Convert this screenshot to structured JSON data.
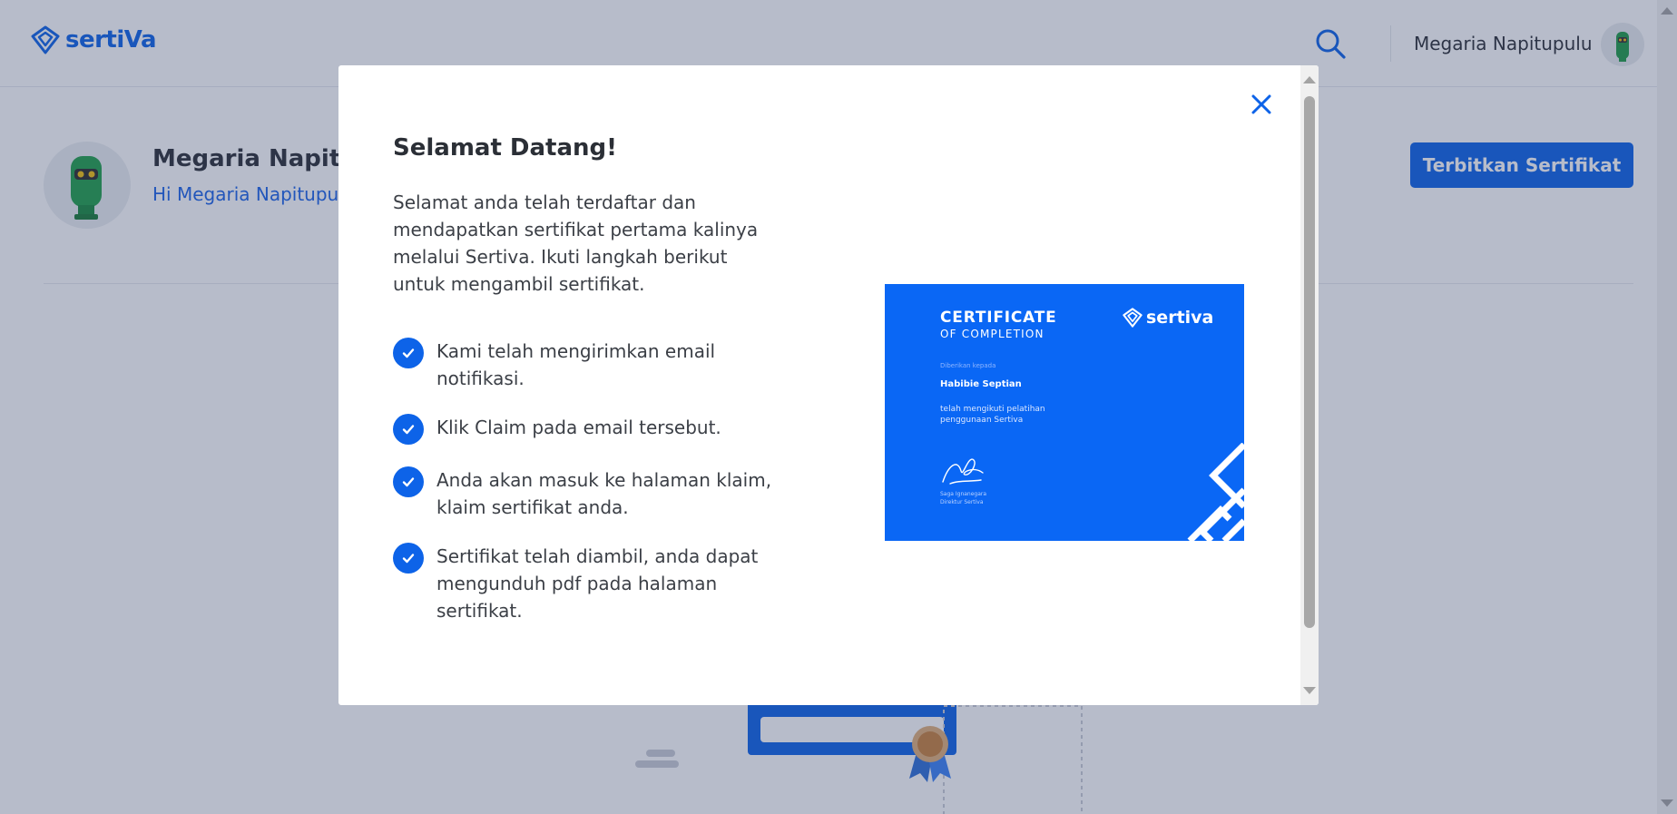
{
  "header": {
    "logo_text": "sertiVa",
    "user_name": "Megaria Napitupulu"
  },
  "profile": {
    "name": "Megaria Napitup",
    "greeting": "Hi Megaria Napitupul",
    "publish_button": "Terbitkan Sertifikat"
  },
  "modal": {
    "title": "Selamat Datang!",
    "intro": "Selamat anda telah terdaftar dan mendapatkan sertifikat pertama kalinya melalui Sertiva. Ikuti langkah berikut untuk mengambil sertifikat.",
    "steps": [
      "Kami telah mengirimkan email notifikasi.",
      "Klik Claim pada email tersebut.",
      "Anda akan masuk ke halaman klaim, klaim sertifikat anda.",
      "Sertifikat telah diambil, anda dapat mengunduh pdf pada halaman sertifikat."
    ],
    "certificate": {
      "title": "CERTIFICATE",
      "subtitle": "OF COMPLETION",
      "logo_text": "sertiva",
      "given_to": "Diberikan kepada",
      "recipient": "Habibie Septian",
      "description": "telah mengikuti pelatihan penggunaan Sertiva",
      "signer": "Saga Ignanegara",
      "signer_role": "Direktur Sertiva"
    }
  },
  "colors": {
    "brand_blue": "#0d63e8",
    "certificate_blue": "#0a67f5",
    "overlay": "rgba(50,62,102,0.35)"
  },
  "icons": [
    "logo-icon",
    "search-icon",
    "avatar-icon",
    "close-icon",
    "check-icon",
    "signature-icon"
  ]
}
